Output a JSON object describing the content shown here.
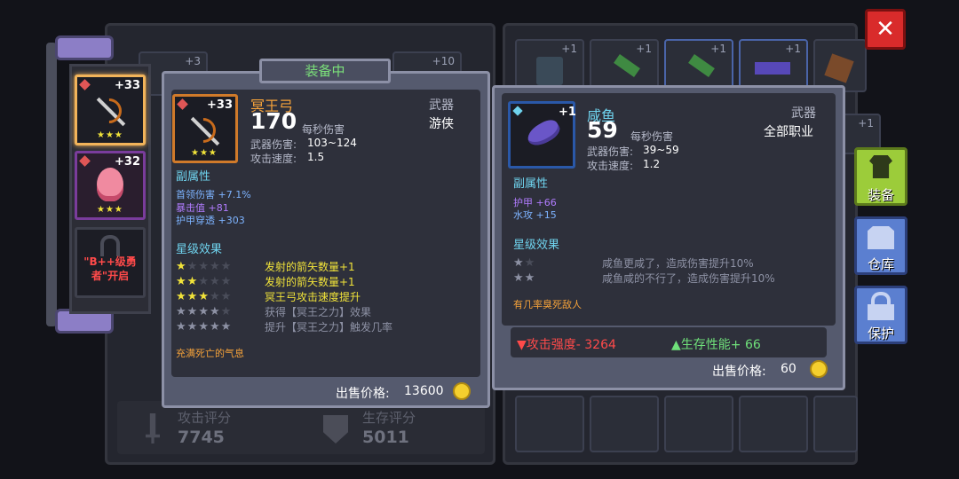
{
  "colors": {
    "accent_orange": "#f5a23a",
    "close_red": "#d92b2b",
    "equip_green": "#9ccc3a",
    "slot_blue": "#5b7fd0"
  },
  "bg_slots": {
    "left_top": [
      "+3",
      "+10"
    ],
    "right_top": [
      "+1",
      "+1",
      "+1",
      "+1"
    ],
    "right_side": [
      "+1"
    ]
  },
  "score": {
    "attack_label": "攻击评分",
    "attack_value": "7745",
    "survive_label": "生存评分",
    "survive_value": "5011"
  },
  "left_list": [
    {
      "badge": "+33",
      "stars": "★★★",
      "icon": "dark-bow-icon"
    },
    {
      "badge": "+32",
      "stars": "★★★",
      "icon": "flame-weapon-icon"
    },
    {
      "locked_text": "\"B++级勇者\"开启",
      "icon": "lock-icon"
    }
  ],
  "equipped": {
    "header": "装备中",
    "badge": "+33",
    "stars": "★★★",
    "name": "冥王弓",
    "dps": "170",
    "dps_label": "每秒伤害",
    "type": "武器",
    "class": "游侠",
    "damage_label": "武器伤害:",
    "damage": "103~124",
    "speed_label": "攻击速度:",
    "speed": "1.5",
    "sub_title": "副属性",
    "sub_attrs": [
      {
        "label": "首领伤害",
        "value": "+7.1%",
        "color": "#7db3ff"
      },
      {
        "label": "暴击值",
        "value": "+81",
        "color": "#b17cff"
      },
      {
        "label": "护甲穿透",
        "value": "+303",
        "color": "#7db3ff"
      }
    ],
    "star_title": "星级效果",
    "star_effects": [
      {
        "filled": 1,
        "text": "发射的箭矢数量+1",
        "active": true
      },
      {
        "filled": 2,
        "text": "发射的箭矢数量+1",
        "active": true
      },
      {
        "filled": 3,
        "text": "冥王弓攻击速度提升",
        "active": true
      },
      {
        "filled": 4,
        "text": "获得【冥王之力】效果",
        "active": false
      },
      {
        "filled": 5,
        "text": "提升【冥王之力】触发几率",
        "active": false
      }
    ],
    "flavor": "充满死亡的气息",
    "sell_label": "出售价格:",
    "sell_price": "13600"
  },
  "compare": {
    "badge": "+1",
    "name": "咸鱼",
    "dps": "59",
    "dps_label": "每秒伤害",
    "type": "武器",
    "class": "全部职业",
    "damage_label": "武器伤害:",
    "damage": "39~59",
    "speed_label": "攻击速度:",
    "speed": "1.2",
    "sub_title": "副属性",
    "sub_attrs": [
      {
        "label": "护甲",
        "value": "+66",
        "color": "#b17cff"
      },
      {
        "label": "水攻",
        "value": "+15",
        "color": "#7db3ff"
      }
    ],
    "star_title": "星级效果",
    "star_effects": [
      {
        "filled": 1,
        "total": 2,
        "text": "咸鱼更咸了，造成伤害提升10%"
      },
      {
        "filled": 2,
        "total": 2,
        "text": "咸鱼咸的不行了，造成伤害提升10%"
      }
    ],
    "flavor": "有几率臭死敌人",
    "diff_attack": "▼攻击强度- 3264",
    "diff_survive": "▲生存性能+ 66",
    "sell_label": "出售价格:",
    "sell_price": "60"
  },
  "side_buttons": [
    {
      "label": "装备",
      "icon": "armor-icon",
      "color": "#9ccc3a"
    },
    {
      "label": "仓库",
      "icon": "storage-icon",
      "color": "#5b7fd0"
    },
    {
      "label": "保护",
      "icon": "lock-icon",
      "color": "#5b7fd0"
    }
  ]
}
